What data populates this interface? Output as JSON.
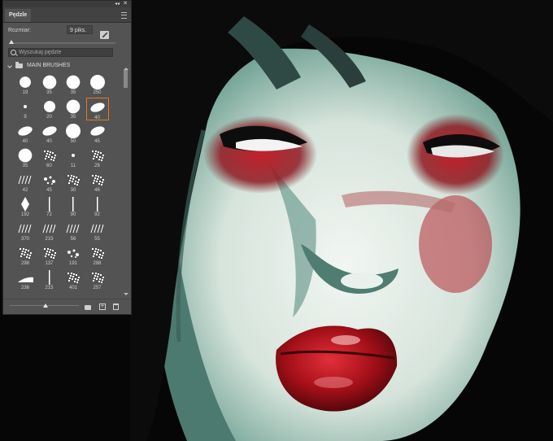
{
  "panel": {
    "tab_label": "Pędzle",
    "collapse_glyph": "◂◂",
    "close_glyph": "✕",
    "size_label": "Rozmiar:",
    "size_value": "9 piks.",
    "search_placeholder": "Wyszukaj pędzle",
    "group_name": "MAIN BRUSHES",
    "accent_color": "#e07a20"
  },
  "brushes": [
    {
      "size": "19",
      "shape": "round-soft"
    },
    {
      "size": "35",
      "shape": "round-soft"
    },
    {
      "size": "35",
      "shape": "round-soft"
    },
    {
      "size": "250",
      "shape": "round-soft"
    },
    {
      "size": "9",
      "shape": "dot"
    },
    {
      "size": "20",
      "shape": "round-soft"
    },
    {
      "size": "35",
      "shape": "round-soft"
    },
    {
      "size": "40",
      "shape": "ellipse",
      "selected": true
    },
    {
      "size": "40",
      "shape": "ellipse"
    },
    {
      "size": "40",
      "shape": "ellipse"
    },
    {
      "size": "50",
      "shape": "round-soft"
    },
    {
      "size": "45",
      "shape": "ellipse"
    },
    {
      "size": "35",
      "shape": "round-soft"
    },
    {
      "size": "60",
      "shape": "texture"
    },
    {
      "size": "11",
      "shape": "dot"
    },
    {
      "size": "28",
      "shape": "texture"
    },
    {
      "size": "42",
      "shape": "stroke"
    },
    {
      "size": "45",
      "shape": "splatter"
    },
    {
      "size": "30",
      "shape": "texture"
    },
    {
      "size": "46",
      "shape": "texture"
    },
    {
      "size": "192",
      "shape": "diamond"
    },
    {
      "size": "72",
      "shape": "line"
    },
    {
      "size": "90",
      "shape": "line"
    },
    {
      "size": "92",
      "shape": "line"
    },
    {
      "size": "370",
      "shape": "stroke"
    },
    {
      "size": "215",
      "shape": "stroke"
    },
    {
      "size": "56",
      "shape": "stroke"
    },
    {
      "size": "55",
      "shape": "stroke"
    },
    {
      "size": "298",
      "shape": "texture"
    },
    {
      "size": "137",
      "shape": "texture"
    },
    {
      "size": "191",
      "shape": "splatter"
    },
    {
      "size": "288",
      "shape": "texture"
    },
    {
      "size": "236",
      "shape": "wedge"
    },
    {
      "size": "215",
      "shape": "line"
    },
    {
      "size": "401",
      "shape": "texture"
    },
    {
      "size": "257",
      "shape": "texture"
    }
  ],
  "colors": {
    "panel_bg": "#535353",
    "skin": "#dfe9e2",
    "shadow_teal": "#5f8d82",
    "blush_red": "#b8202a",
    "lip_red": "#c0121f",
    "hair": "#0b0b0b"
  }
}
